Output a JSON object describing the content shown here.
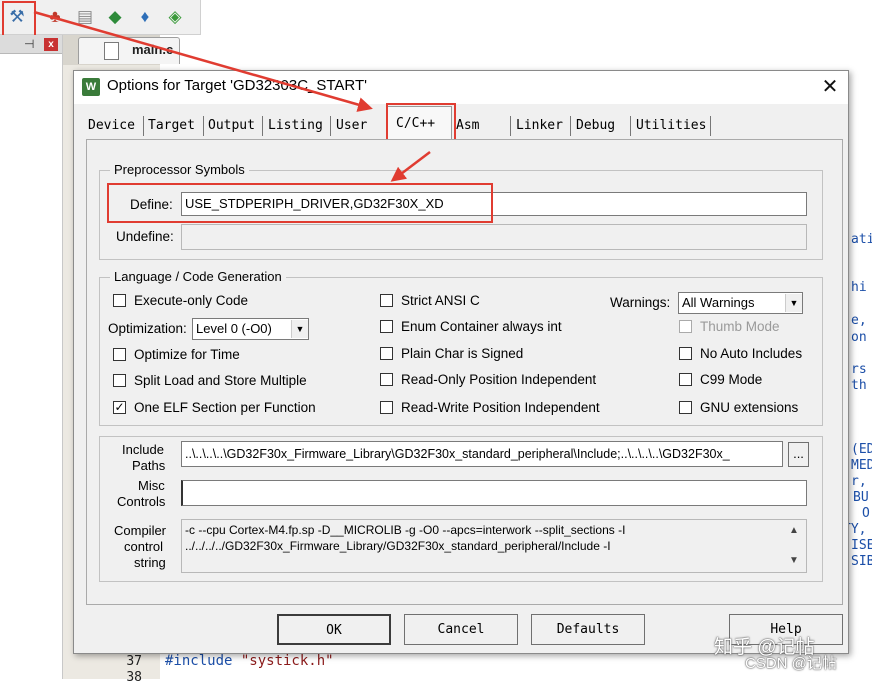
{
  "ide": {
    "file_tab": "main.c",
    "pin_glyph": "⊣",
    "close_glyph": "x",
    "right_fragments": [
      "ati",
      "hi",
      "e,",
      "on",
      "rs",
      "th",
      "(ED",
      "MED",
      "r,",
      "BU",
      "O",
      "TY,",
      "ISE",
      "SIB"
    ],
    "line_numbers": [
      "37",
      "38"
    ],
    "code_line": "#include \"systick.h\""
  },
  "toolbar_icons": [
    "options-for-target-icon",
    "manage-components-icon",
    "select-packs-icon",
    "pack-installer-icon",
    "component-icon",
    "device-database-icon"
  ],
  "dialog": {
    "title": "Options for Target 'GD32303C_START'",
    "close": "✕",
    "tabs": [
      "Device",
      "Target",
      "Output",
      "Listing",
      "User",
      "C/C++",
      "Asm",
      "Linker",
      "Debug",
      "Utilities"
    ],
    "active_tab": "C/C++",
    "preprocessor": {
      "group_label": "Preprocessor Symbols",
      "define_label": "Define:",
      "define_value": "USE_STDPERIPH_DRIVER,GD32F30X_XD",
      "undefine_label": "Undefine:",
      "undefine_value": ""
    },
    "language": {
      "group_label": "Language / Code Generation",
      "execute_only": "Execute-only Code",
      "optimization_label": "Optimization:",
      "optimization_value": "Level 0 (-O0)",
      "optimize_time": "Optimize for Time",
      "split_load": "Split Load and Store Multiple",
      "one_elf": "One ELF Section per Function",
      "strict_ansi": "Strict ANSI C",
      "enum_container": "Enum Container always int",
      "plain_char": "Plain Char is Signed",
      "ro_pi": "Read-Only Position Independent",
      "rw_pi": "Read-Write Position Independent",
      "warnings_label": "Warnings:",
      "warnings_value": "All Warnings",
      "thumb_mode": "Thumb Mode",
      "no_auto_includes": "No Auto Includes",
      "c99_mode": "C99 Mode",
      "gnu_extensions": "GNU extensions",
      "checked": {
        "execute_only": false,
        "optimize_time": false,
        "split_load": false,
        "one_elf": true,
        "strict_ansi": false,
        "enum_container": false,
        "plain_char": false,
        "ro_pi": false,
        "rw_pi": false,
        "thumb_mode": false,
        "no_auto_includes": false,
        "c99_mode": false,
        "gnu_extensions": false
      },
      "check_mark": "✓"
    },
    "include_label_1": "Include",
    "include_label_2": "Paths",
    "include_value": "..\\..\\..\\..\\GD32F30x_Firmware_Library\\GD32F30x_standard_peripheral\\Include;..\\..\\..\\..\\GD32F30x_",
    "browse": "...",
    "misc_label_1": "Misc",
    "misc_label_2": "Controls",
    "misc_value": "",
    "compiler_label_1": "Compiler",
    "compiler_label_2": "control",
    "compiler_label_3": "string",
    "compiler_line_1": "-c --cpu Cortex-M4.fp.sp -D__MICROLIB -g -O0 --apcs=interwork --split_sections -I",
    "compiler_line_2": "../../../../GD32F30x_Firmware_Library/GD32F30x_standard_peripheral/Include -I",
    "scroll_up": "▲",
    "scroll_down": "▼",
    "buttons": {
      "ok": "OK",
      "cancel": "Cancel",
      "defaults": "Defaults",
      "help": "Help"
    },
    "dropdown_arrow": "▼"
  },
  "watermark": {
    "line1": "知乎 @记帖",
    "line2": "CSDN @记帖"
  },
  "colors": {
    "annotation_red": "#e03c31"
  }
}
